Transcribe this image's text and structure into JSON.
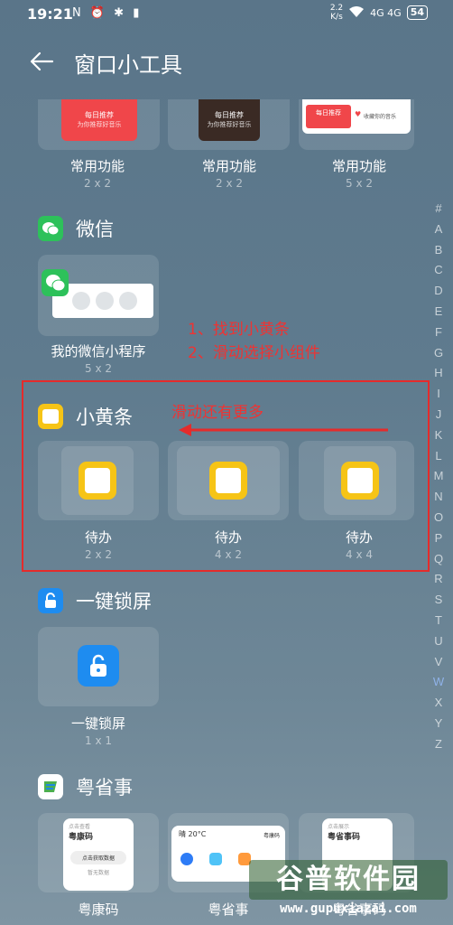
{
  "status": {
    "time": "19:21",
    "left_icons": "N ⏰ ✱ ▮",
    "speed_top": "2.2",
    "speed_bottom": "K/s",
    "network": "4G 4G",
    "battery": "54"
  },
  "header": {
    "title": "窗口小工具"
  },
  "top_row": {
    "items": [
      {
        "label": "常用功能",
        "size": "2 x 2",
        "thumb_title": "每日推荐",
        "thumb_sub": "为你推荐好音乐"
      },
      {
        "label": "常用功能",
        "size": "2 x 2",
        "thumb_title": "每日推荐",
        "thumb_sub": "为你推荐好音乐"
      },
      {
        "label": "常用功能",
        "size": "5 x 2",
        "thumb_title": "每日推荐",
        "thumb_sub": "收藏你的音乐"
      }
    ]
  },
  "wechat": {
    "title": "微信",
    "widget": {
      "label": "我的微信小程序",
      "size": "5 x 2"
    }
  },
  "annotations": {
    "step1": "1、找到小黄条",
    "step2": "2、滑动选择小组件",
    "swipe": "滑动还有更多"
  },
  "xiaohuangtiao": {
    "title": "小黄条",
    "widgets": [
      {
        "label": "待办",
        "size": "2 x 2"
      },
      {
        "label": "待办",
        "size": "4 x 2"
      },
      {
        "label": "待办",
        "size": "4 x 4"
      }
    ]
  },
  "lockscreen": {
    "title": "一键锁屏",
    "widget": {
      "label": "一键锁屏",
      "size": "1 x 1"
    }
  },
  "yueshengshi": {
    "title": "粤省事",
    "widgets": [
      {
        "label": "粤康码",
        "thumb_title": "粤康码",
        "thumb_btn": "点击获取数据",
        "thumb_foot": "暂无数据",
        "thumb_top": "点击查看"
      },
      {
        "label": "粤省事",
        "thumb_title": "晴 20°C",
        "thumb_sub": "粤康码"
      },
      {
        "label": "粤省事码",
        "thumb_title": "粤省事码",
        "thumb_top": "点击展示"
      }
    ]
  },
  "alpha_index": [
    "#",
    "A",
    "B",
    "C",
    "D",
    "E",
    "F",
    "G",
    "H",
    "I",
    "J",
    "K",
    "L",
    "M",
    "N",
    "O",
    "P",
    "Q",
    "R",
    "S",
    "T",
    "U",
    "V",
    "W",
    "X",
    "Y",
    "Z"
  ],
  "alpha_active": "W",
  "watermark": {
    "brand": "谷普软件园",
    "url": "www.gupuxiazai.com"
  },
  "colors": {
    "accent_red": "#e52b2b",
    "wechat_green": "#2dc15a",
    "note_yellow": "#f6c416",
    "lock_blue": "#1e8cf0"
  }
}
